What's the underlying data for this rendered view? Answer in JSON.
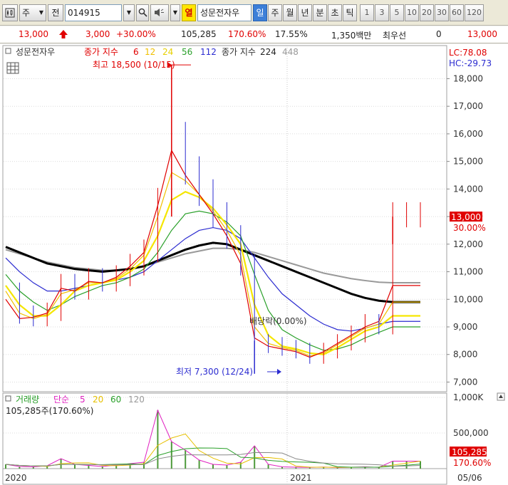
{
  "toolbar": {
    "market_btn": "주",
    "prev_btn": "전",
    "code": "014915",
    "stock_name_flag": "열",
    "stock_name": "성문전자우",
    "periods": [
      "일",
      "주",
      "월",
      "년",
      "분",
      "초",
      "틱"
    ],
    "active_period": "일",
    "intervals": [
      "1",
      "3",
      "5",
      "10",
      "20",
      "30",
      "60",
      "120"
    ]
  },
  "quote": {
    "price": "13,000",
    "change": "3,000",
    "change_pct": "+30.00%",
    "volume": "105,285",
    "volume_ratio": "170.60%",
    "turnover": "17.55%",
    "amount": "1,350백만",
    "best_bid_label": "최우선",
    "best_bid_qty": "0",
    "best_bid_price": "13,000"
  },
  "colors": {
    "price_bar": "#e00000",
    "ma6": "#e00000",
    "ma12": "#f0c000",
    "ma24": "#f5e600",
    "ma56": "#2aa02a",
    "ma112": "#2b2bd0",
    "ma224": "#000000",
    "ma448": "#999999",
    "volume_bar": "#4d9a3a",
    "vol_ma5": "#e020c0",
    "vol_ma20": "#e6c000",
    "vol_ma60": "#2aa02a",
    "vol_ma120": "#888888"
  },
  "chart_data": [
    {
      "type": "line",
      "title": "성문전자우",
      "legend": {
        "price_label": "종가 지수",
        "ma_periods": [
          "6",
          "12",
          "24",
          "56",
          "112"
        ],
        "ma_label2": "종가 지수",
        "ma_periods2": [
          "224",
          "448"
        ]
      },
      "y_ticks": [
        7000,
        8000,
        9000,
        10000,
        11000,
        12000,
        13000,
        14000,
        15000,
        16000,
        17000,
        18000
      ],
      "y_tick_labels": [
        "7,000",
        "8,000",
        "9,000",
        "10,000",
        "11,000",
        "12,000",
        "13,000",
        "14,000",
        "15,000",
        "16,000",
        "17,000",
        "18,000"
      ],
      "ylim": [
        6650,
        19200
      ],
      "x_labels": [
        "2020",
        "2021"
      ],
      "x_date_label": "05/06",
      "lc": "LC:78.08",
      "hc": "HC:-29.73",
      "current_price_label": "13,000",
      "current_pct_label": "30.00%",
      "current_price": 13000,
      "annotations": {
        "high": "최고 18,500 (10/15)",
        "high_value": 18500,
        "low": "최저 7,300 (12/24)",
        "low_value": 7300,
        "dividend": "배당락(0.00%)"
      },
      "series_x": [
        0,
        20,
        40,
        60,
        80,
        100,
        120,
        140,
        160,
        180,
        200,
        220,
        240,
        260,
        280,
        300,
        320,
        340,
        360,
        380,
        400,
        420,
        440,
        460,
        480,
        500,
        520,
        540,
        560,
        580,
        600
      ],
      "series": [
        {
          "name": "종가",
          "values": [
            10200,
            9400,
            9300,
            9500,
            10500,
            10300,
            10700,
            10600,
            10800,
            11200,
            11700,
            13500,
            15800,
            14600,
            13800,
            13000,
            12200,
            11200,
            8400,
            8300,
            8200,
            8100,
            7900,
            8100,
            8400,
            8700,
            9100,
            9000,
            13000,
            13000,
            13000
          ]
        },
        {
          "name": "6",
          "values": [
            10000,
            9300,
            9350,
            9500,
            10400,
            10300,
            10650,
            10600,
            10800,
            11200,
            11700,
            13400,
            15400,
            14500,
            13800,
            13100,
            12300,
            11300,
            8600,
            8300,
            8200,
            8100,
            7900,
            8100,
            8400,
            8700,
            9000,
            9200,
            10500,
            10500,
            10500
          ]
        },
        {
          "name": "12",
          "values": [
            10300,
            9500,
            9300,
            9450,
            10200,
            10350,
            10600,
            10600,
            10750,
            11100,
            11600,
            13000,
            14600,
            14300,
            13800,
            13200,
            12500,
            11600,
            9000,
            8400,
            8250,
            8150,
            7950,
            8050,
            8350,
            8650,
            8950,
            9100,
            9900,
            9900,
            9900
          ]
        },
        {
          "name": "24",
          "values": [
            10500,
            9800,
            9400,
            9400,
            9800,
            10300,
            10500,
            10600,
            10700,
            11000,
            11400,
            12300,
            13600,
            13900,
            13700,
            13300,
            12700,
            12000,
            9800,
            8700,
            8300,
            8200,
            8050,
            8000,
            8250,
            8550,
            8850,
            9000,
            9400,
            9400,
            9400
          ]
        },
        {
          "name": "56",
          "values": [
            10900,
            10300,
            9900,
            9600,
            9800,
            10100,
            10300,
            10500,
            10600,
            10800,
            11100,
            11700,
            12500,
            13100,
            13200,
            13100,
            12800,
            12300,
            10900,
            9600,
            8900,
            8600,
            8350,
            8150,
            8200,
            8350,
            8600,
            8800,
            9000,
            9000,
            9000
          ]
        },
        {
          "name": "112",
          "values": [
            11500,
            11000,
            10600,
            10300,
            10300,
            10400,
            10500,
            10600,
            10700,
            10800,
            11000,
            11400,
            11800,
            12200,
            12500,
            12600,
            12500,
            12200,
            11500,
            10800,
            10200,
            9800,
            9400,
            9100,
            8900,
            8850,
            8950,
            9100,
            9200,
            9200,
            9200
          ]
        },
        {
          "name": "224",
          "values": [
            11900,
            11700,
            11500,
            11300,
            11200,
            11100,
            11050,
            11000,
            11050,
            11100,
            11200,
            11400,
            11600,
            11800,
            11950,
            12050,
            12000,
            11800,
            11600,
            11400,
            11200,
            11000,
            10800,
            10600,
            10400,
            10200,
            10050,
            9950,
            9900,
            9900,
            9900
          ]
        },
        {
          "name": "448",
          "values": [
            11800,
            11650,
            11500,
            11350,
            11250,
            11150,
            11100,
            11050,
            11050,
            11100,
            11200,
            11350,
            11500,
            11650,
            11750,
            11850,
            11850,
            11800,
            11700,
            11550,
            11400,
            11250,
            11100,
            10950,
            10850,
            10750,
            10680,
            10620,
            10600,
            10600,
            10600
          ]
        }
      ]
    },
    {
      "type": "bar",
      "title": "거래량",
      "legend": {
        "label": "단순",
        "periods": [
          "5",
          "20",
          "60",
          "120"
        ]
      },
      "current_volume_label": "105,285주(170.60%)",
      "y_ticks": [
        500000,
        1000000
      ],
      "y_tick_labels": [
        "500,000",
        "1,000K"
      ],
      "ylim": [
        0,
        1000000
      ],
      "right_value_label": "105,285",
      "right_pct_label": "170.60%",
      "x": [
        0,
        20,
        40,
        60,
        80,
        100,
        120,
        140,
        160,
        180,
        200,
        220,
        240,
        260,
        280,
        300,
        320,
        340,
        360,
        380,
        400,
        420,
        440,
        460,
        480,
        500,
        520,
        540,
        560,
        580,
        600
      ],
      "values": [
        60000,
        30000,
        25000,
        40000,
        140000,
        60000,
        45000,
        30000,
        50000,
        70000,
        90000,
        820000,
        380000,
        260000,
        120000,
        60000,
        50000,
        90000,
        320000,
        60000,
        25000,
        20000,
        18000,
        22000,
        15000,
        20000,
        25000,
        18000,
        105285,
        105285,
        105285
      ]
    }
  ]
}
